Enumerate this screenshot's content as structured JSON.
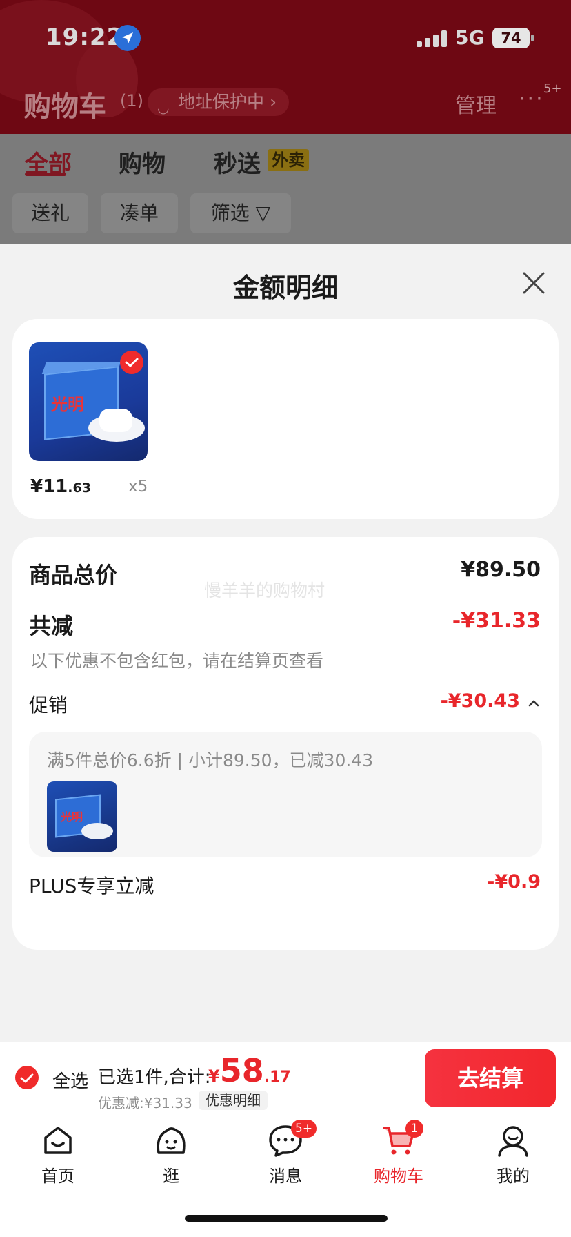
{
  "status_bar": {
    "time": "19:22",
    "network": "5G",
    "battery": "74"
  },
  "header": {
    "title": "购物车",
    "count": "(1)",
    "address_protect": "地址保护中 ›",
    "manage": "管理",
    "more_badge": "5+"
  },
  "tabs": [
    {
      "label": "全部"
    },
    {
      "label": "购物"
    },
    {
      "label": "秒送"
    }
  ],
  "takeout_badge": "外卖",
  "filter_chips": [
    {
      "label": "送礼"
    },
    {
      "label": "凑单"
    },
    {
      "label": "筛选 ▽"
    }
  ],
  "sheet": {
    "title": "金额明细",
    "item": {
      "brand_text": "光明",
      "price_int": "¥11",
      "price_dec": ".63",
      "qty": "x5"
    },
    "watermark": "慢羊羊的购物村",
    "rows": {
      "goods_total_label": "商品总价",
      "goods_total_value": "¥89.50",
      "total_reduce_label": "共减",
      "total_reduce_value": "-¥31.33",
      "hint": "以下优惠不包含红包，请在结算页查看",
      "promo_label": "促销",
      "promo_value": "-¥30.43",
      "promo_detail": "满5件总价6.6折 | 小计89.50，已减30.43",
      "plus_label": "PLUS专享立减",
      "plus_value": "-¥0.9"
    }
  },
  "checkout": {
    "select_all": "全选",
    "selected_summary": "已选1件,合计:",
    "total_currency": "¥",
    "total_int": "58",
    "total_dec": ".17",
    "discount": "优惠减:¥31.33",
    "detail_link": "优惠明细",
    "button": "去结算"
  },
  "tabbar": [
    {
      "label": "首页",
      "icon": "home-icon"
    },
    {
      "label": "逛",
      "icon": "browse-icon"
    },
    {
      "label": "消息",
      "icon": "message-icon",
      "badge": "5+"
    },
    {
      "label": "购物车",
      "icon": "cart-icon",
      "badge": "1"
    },
    {
      "label": "我的",
      "icon": "profile-icon"
    }
  ],
  "colors": {
    "accent": "#e8262b",
    "header_bg": "#6e0813",
    "price_red": "#e8262b"
  }
}
